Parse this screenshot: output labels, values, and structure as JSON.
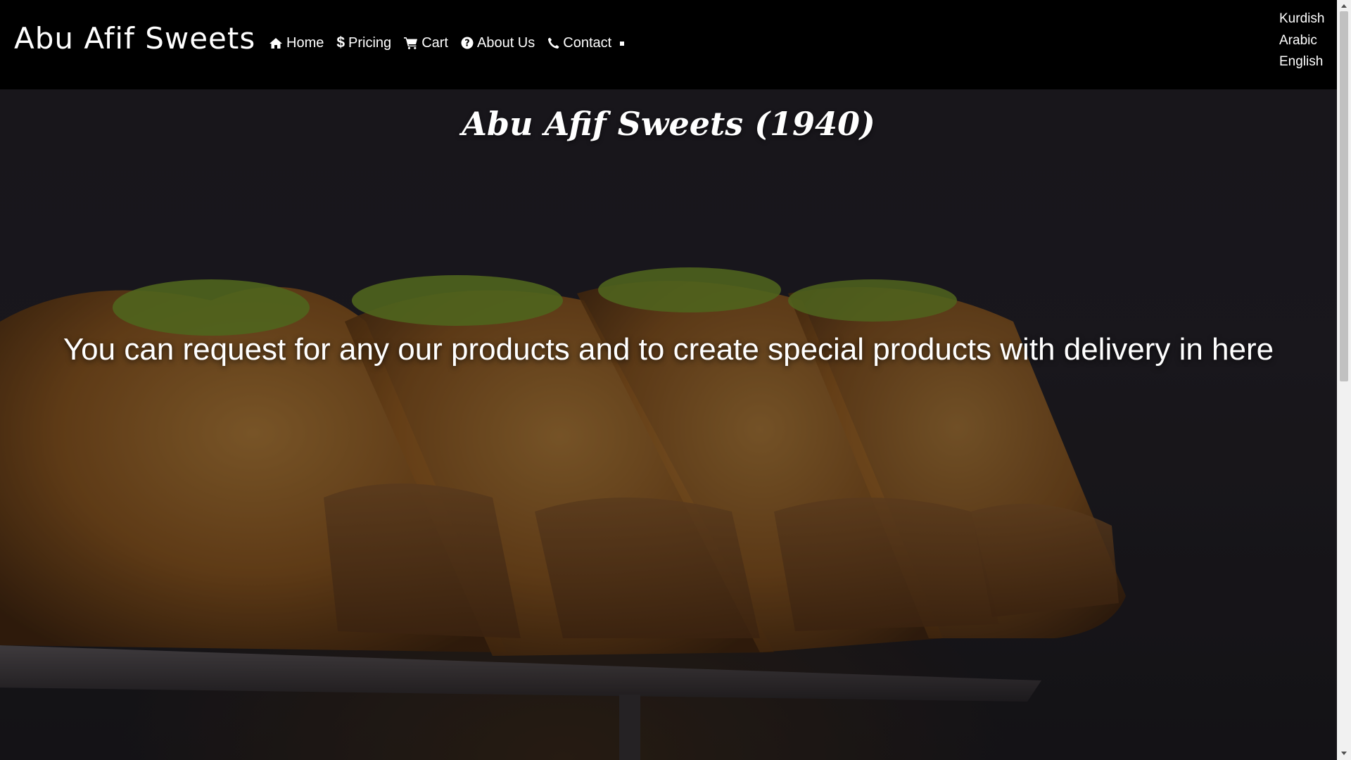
{
  "navbar": {
    "brand": "Abu Afif Sweets",
    "links": [
      {
        "label": "Home",
        "icon": "home-icon"
      },
      {
        "label": "Pricing",
        "icon": "dollar-icon"
      },
      {
        "label": "Cart",
        "icon": "cart-icon"
      },
      {
        "label": "About Us",
        "icon": "question-circle-icon"
      },
      {
        "label": "Contact",
        "icon": "phone-icon"
      }
    ],
    "languages": [
      "Kurdish",
      "Arabic",
      "English"
    ]
  },
  "hero": {
    "title": "Abu Afif Sweets (1940)",
    "tagline": "You can request for any our products and to create special products with delivery in here",
    "image": "baklava-pastry-photo"
  },
  "colors": {
    "navbar_bg": "#000000",
    "text": "#ffffff",
    "hero_bg": "#25222a",
    "pistachio": "#7a9a2e",
    "pastry": "#b8782e"
  }
}
